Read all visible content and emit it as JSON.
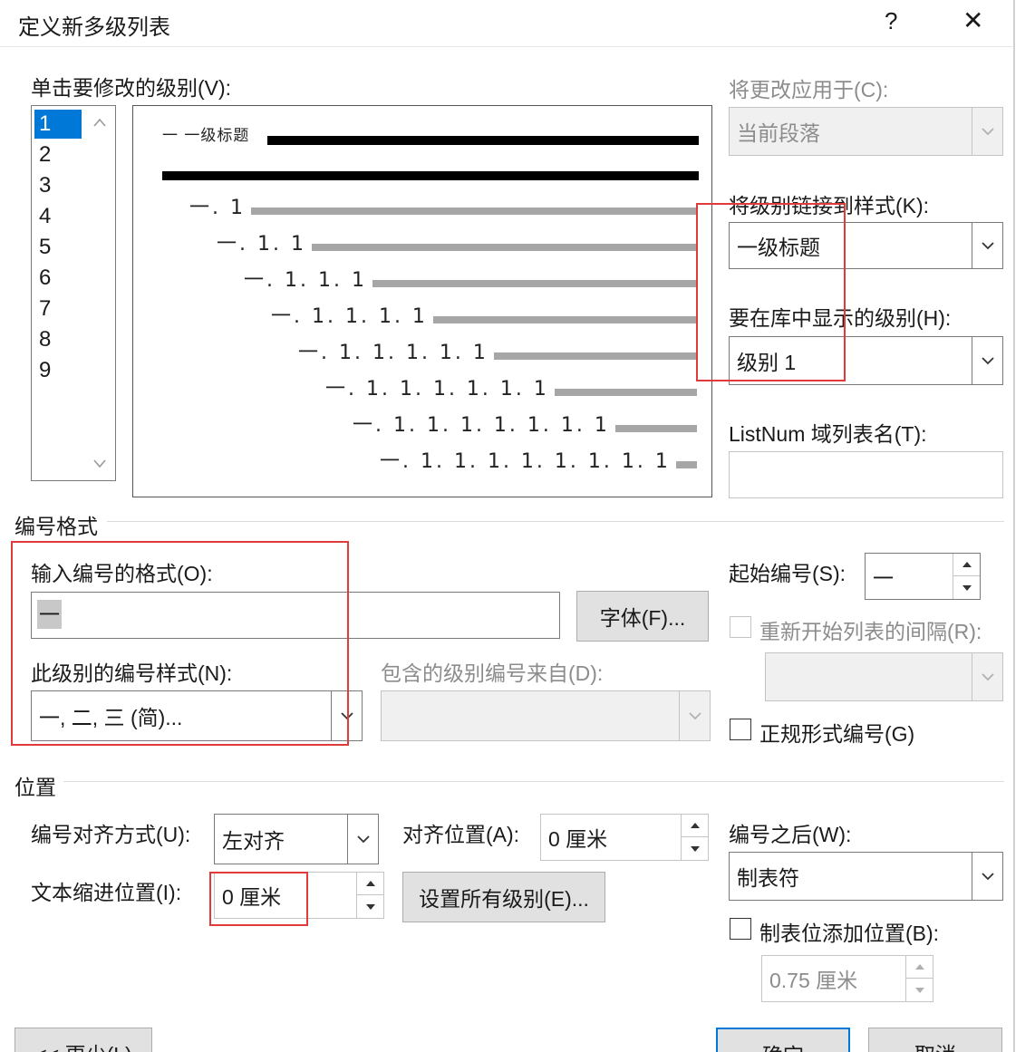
{
  "dialog": {
    "title": "定义新多级列表",
    "help_label": "?",
    "close_label": "✕"
  },
  "level_list": {
    "label": "单击要修改的级别(V):",
    "items": [
      "1",
      "2",
      "3",
      "4",
      "5",
      "6",
      "7",
      "8",
      "9"
    ],
    "selected": "1"
  },
  "preview": {
    "heading_text": "一 一级标题",
    "lines": [
      "一. 1",
      "一. 1. 1",
      "一. 1. 1. 1",
      "一. 1. 1. 1. 1",
      "一. 1. 1. 1. 1. 1",
      "一. 1. 1. 1. 1. 1. 1",
      "一. 1. 1. 1. 1. 1. 1. 1",
      "一. 1. 1. 1. 1. 1. 1. 1. 1"
    ]
  },
  "apply_to": {
    "label": "将更改应用于(C):",
    "value": "当前段落"
  },
  "link_style": {
    "label": "将级别链接到样式(K):",
    "value": "一级标题"
  },
  "gallery_level": {
    "label": "要在库中显示的级别(H):",
    "value": "级别 1"
  },
  "listnum": {
    "label": "ListNum 域列表名(T):",
    "value": ""
  },
  "number_format": {
    "section_title": "编号格式",
    "format_label": "输入编号的格式(O):",
    "format_value": "一",
    "font_button": "字体(F)...",
    "style_label": "此级别的编号样式(N):",
    "style_value": "一, 二, 三 (简)...",
    "include_label": "包含的级别编号来自(D):",
    "include_value": "",
    "start_label": "起始编号(S):",
    "start_value": "一",
    "restart_label": "重新开始列表的间隔(R):",
    "legal_label": "正规形式编号(G)"
  },
  "position": {
    "section_title": "位置",
    "align_label": "编号对齐方式(U):",
    "align_value": "左对齐",
    "align_at_label": "对齐位置(A):",
    "align_at_value": "0 厘米",
    "indent_label": "文本缩进位置(I):",
    "indent_value": "0 厘米",
    "set_all_button": "设置所有级别(E)...",
    "follow_label": "编号之后(W):",
    "follow_value": "制表符",
    "tab_stop_label": "制表位添加位置(B):",
    "tab_stop_value": "0.75 厘米"
  },
  "footer": {
    "less_button": "<< 更少(L)",
    "ok_button": "确定",
    "cancel_button": "取消"
  },
  "colors": {
    "annotation_red": "#e03a3a",
    "selection_blue": "#0078d7"
  }
}
